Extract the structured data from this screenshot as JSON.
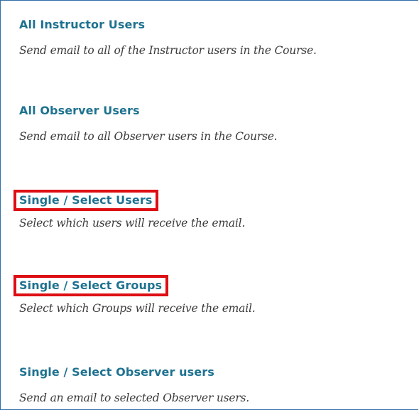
{
  "items": [
    {
      "link": "All Instructor Users",
      "description": "Send email to all of the Instructor users in the Course.",
      "highlighted": false
    },
    {
      "link": "All Observer Users",
      "description": "Send email to all Observer users in the Course.",
      "highlighted": false
    },
    {
      "link": "Single / Select Users",
      "description": "Select which users will receive the email.",
      "highlighted": true
    },
    {
      "link": "Single / Select Groups",
      "description": "Select which Groups will receive the email.",
      "highlighted": true
    },
    {
      "link": "Single / Select Observer users",
      "description": "Send an email to selected Observer users.",
      "highlighted": false
    }
  ],
  "colors": {
    "link": "#1e7290",
    "description": "#3b3b3b",
    "highlight_border": "#dd0f14",
    "frame_border": "#2f6fa8"
  }
}
